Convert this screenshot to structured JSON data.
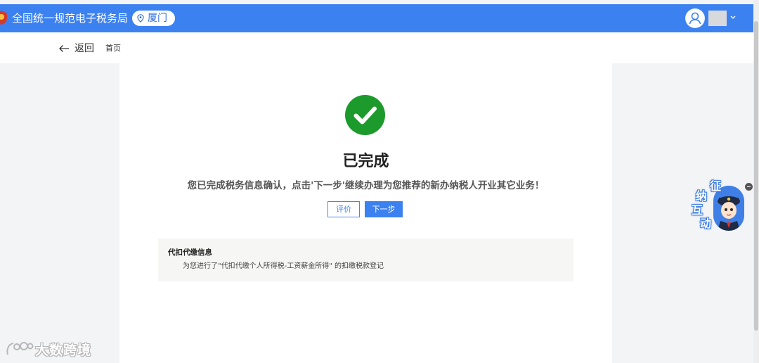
{
  "header": {
    "title": "全国统一规范电子税务局",
    "city": "厦门",
    "logo_icon": "tax-emblem-icon",
    "city_icon": "location-pin-icon",
    "user_icon": "user-avatar-icon",
    "menu_icon": "chevron-down-icon"
  },
  "nav": {
    "back_label": "返回",
    "home_label": "首页"
  },
  "result": {
    "icon": "check-circle-icon",
    "title": "已完成",
    "message": "您已完成税务信息确认，点击'下一步'继续办理为您推荐的新办纳税人开业其它业务！",
    "buttons": {
      "rate": "评价",
      "next": "下一步"
    }
  },
  "info": {
    "title": "代扣代缴信息",
    "detail": "为您进行了\"代扣代缴个人所得税-工资薪金所得\" 的扣缴税款登记"
  },
  "assistant": {
    "chars": [
      "征",
      "纳",
      "互",
      "动"
    ],
    "close_icon": "minus-icon"
  },
  "watermark": {
    "text": "大数跨境"
  },
  "colors": {
    "brand": "#3c81f0",
    "success": "#1c9a2c",
    "card_bg": "#f6f7f5"
  }
}
